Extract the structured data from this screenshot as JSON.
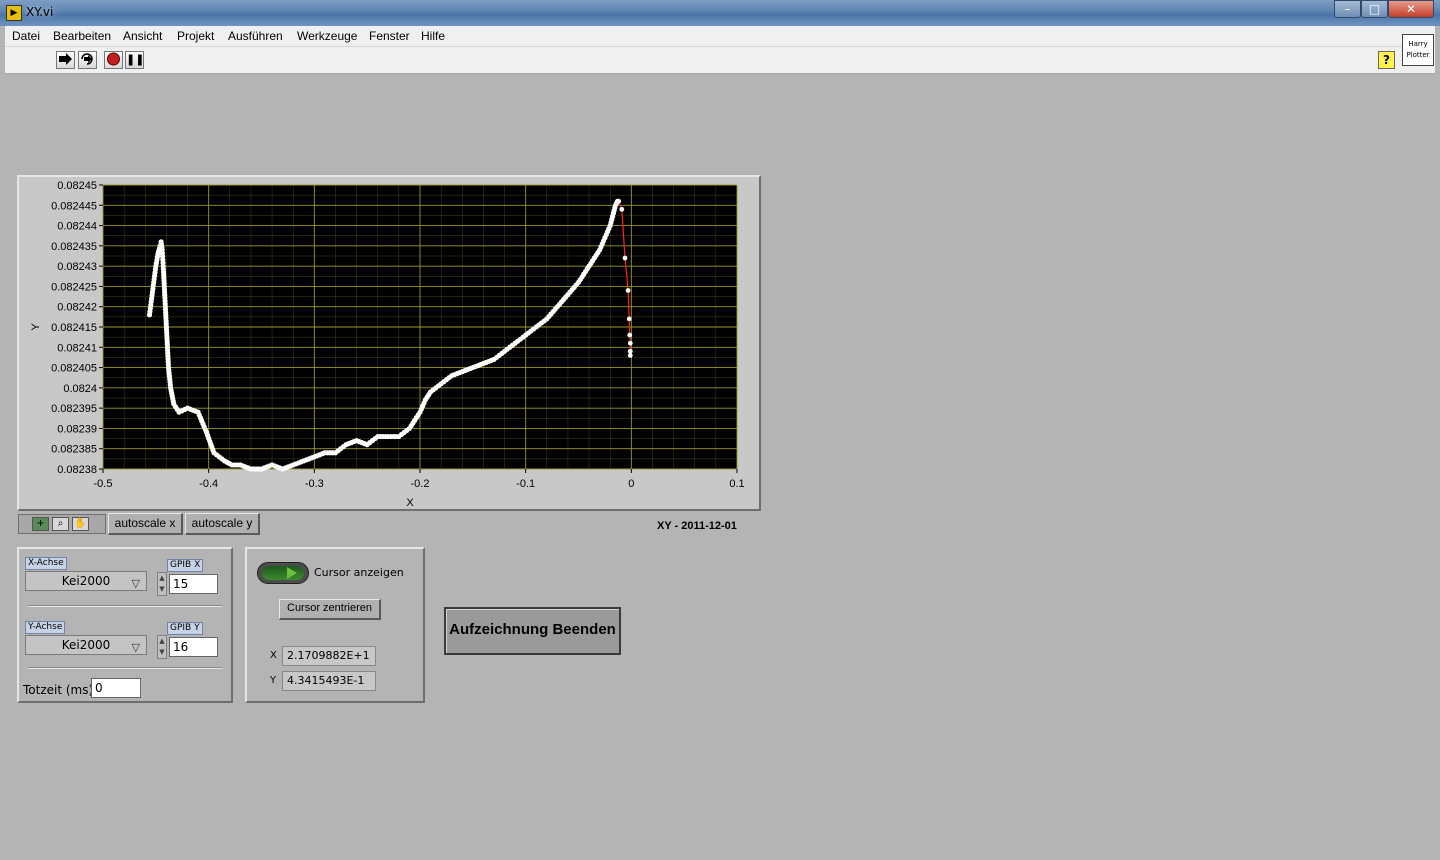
{
  "window": {
    "title": "XY.vi",
    "app_icon": "labview-vi-icon"
  },
  "window_controls": {
    "minimize": "–",
    "maximize": "□",
    "close": "✕"
  },
  "menu": {
    "items": [
      "Datei",
      "Bearbeiten",
      "Ansicht",
      "Projekt",
      "Ausführen",
      "Werkzeuge",
      "Fenster",
      "Hilfe"
    ]
  },
  "toolbar": {
    "icons": [
      "run-arrow-icon",
      "run-continuously-icon",
      "abort-icon",
      "pause-icon"
    ],
    "pause_glyph": "❚❚",
    "help_glyph": "?"
  },
  "vi_icon": {
    "line1": "Harry",
    "line2": "Plotter"
  },
  "graph": {
    "xlabel": "X",
    "ylabel": "Y",
    "caption": "XY - 2011-12-01",
    "autoscale_x": "autoscale x",
    "autoscale_y": "autoscale y",
    "colors": {
      "plot_bg": "#000000",
      "grid": "#9a9a2a",
      "points": "#ffffff",
      "line": "#ff2020",
      "frame": "#c8c8c8"
    }
  },
  "chart_data": {
    "type": "scatter",
    "title": "",
    "xlabel": "X",
    "ylabel": "Y",
    "xlim": [
      -0.5,
      0.1
    ],
    "ylim": [
      0.08238,
      0.08245
    ],
    "xticks": [
      "-0.5",
      "-0.4",
      "-0.3",
      "-0.2",
      "-0.1",
      "0",
      "0.1"
    ],
    "yticks": [
      "0.08245",
      "0.082445",
      "0.08244",
      "0.082435",
      "0.08243",
      "0.082425",
      "0.08242",
      "0.082415",
      "0.08241",
      "0.082405",
      "0.0824",
      "0.082395",
      "0.08239",
      "0.082385",
      "0.08238"
    ],
    "grid": true,
    "series": [
      {
        "style": "points",
        "x": [
          -0.456,
          -0.454,
          -0.452,
          -0.45,
          -0.448,
          -0.446,
          -0.445,
          -0.444,
          -0.443,
          -0.442,
          -0.441,
          -0.44,
          -0.439,
          -0.438,
          -0.436,
          -0.433,
          -0.428,
          -0.42,
          -0.41,
          -0.402,
          -0.395,
          -0.39,
          -0.385,
          -0.378,
          -0.37,
          -0.36,
          -0.35,
          -0.34,
          -0.33,
          -0.32,
          -0.31,
          -0.3,
          -0.29,
          -0.28,
          -0.27,
          -0.26,
          -0.25,
          -0.24,
          -0.23,
          -0.22,
          -0.21,
          -0.2,
          -0.195,
          -0.19,
          -0.18,
          -0.17,
          -0.16,
          -0.15,
          -0.14,
          -0.13,
          -0.12,
          -0.11,
          -0.1,
          -0.09,
          -0.08,
          -0.07,
          -0.06,
          -0.05,
          -0.04,
          -0.03,
          -0.025,
          -0.02,
          -0.017,
          -0.015,
          -0.013
        ],
        "y": [
          0.082418,
          0.082422,
          0.082426,
          0.08243,
          0.082433,
          0.082435,
          0.082436,
          0.082434,
          0.08243,
          0.082425,
          0.08242,
          0.082415,
          0.08241,
          0.082405,
          0.0824,
          0.082396,
          0.082394,
          0.082395,
          0.082394,
          0.082389,
          0.082384,
          0.082383,
          0.082382,
          0.082381,
          0.082381,
          0.08238,
          0.08238,
          0.082381,
          0.08238,
          0.082381,
          0.082382,
          0.082383,
          0.082384,
          0.082384,
          0.082386,
          0.082387,
          0.082386,
          0.082388,
          0.082388,
          0.082388,
          0.08239,
          0.082394,
          0.082397,
          0.082399,
          0.082401,
          0.082403,
          0.082404,
          0.082405,
          0.082406,
          0.082407,
          0.082409,
          0.082411,
          0.082413,
          0.082415,
          0.082417,
          0.08242,
          0.082423,
          0.082426,
          0.08243,
          0.082434,
          0.082437,
          0.08244,
          0.082443,
          0.082445,
          0.082446
        ]
      },
      {
        "style": "line+points",
        "x": [
          -0.012,
          -0.009,
          -0.006,
          -0.003,
          -0.002,
          -0.0015,
          -0.001,
          -0.001,
          -0.001
        ],
        "y": [
          0.082446,
          0.082444,
          0.082432,
          0.082424,
          0.082417,
          0.082413,
          0.082411,
          0.082409,
          0.082408
        ]
      }
    ]
  },
  "settings": {
    "x_axis": {
      "label": "X-Achse",
      "value": "Kei2000",
      "gpib_label": "GPIB X",
      "gpib_value": "15"
    },
    "y_axis": {
      "label": "Y-Achse",
      "value": "Kei2000",
      "gpib_label": "GPIB Y",
      "gpib_value": "16"
    },
    "dead_time": {
      "label": "Totzeit (ms)",
      "value": "0"
    }
  },
  "cursor": {
    "toggle_label": "Cursor anzeigen",
    "center_button": "Cursor zentrieren",
    "x_label": "X",
    "x_value": "2.1709882E+1",
    "y_label": "Y",
    "y_value": "4.3415493E-1"
  },
  "stop_button": "Aufzeichnung Beenden"
}
